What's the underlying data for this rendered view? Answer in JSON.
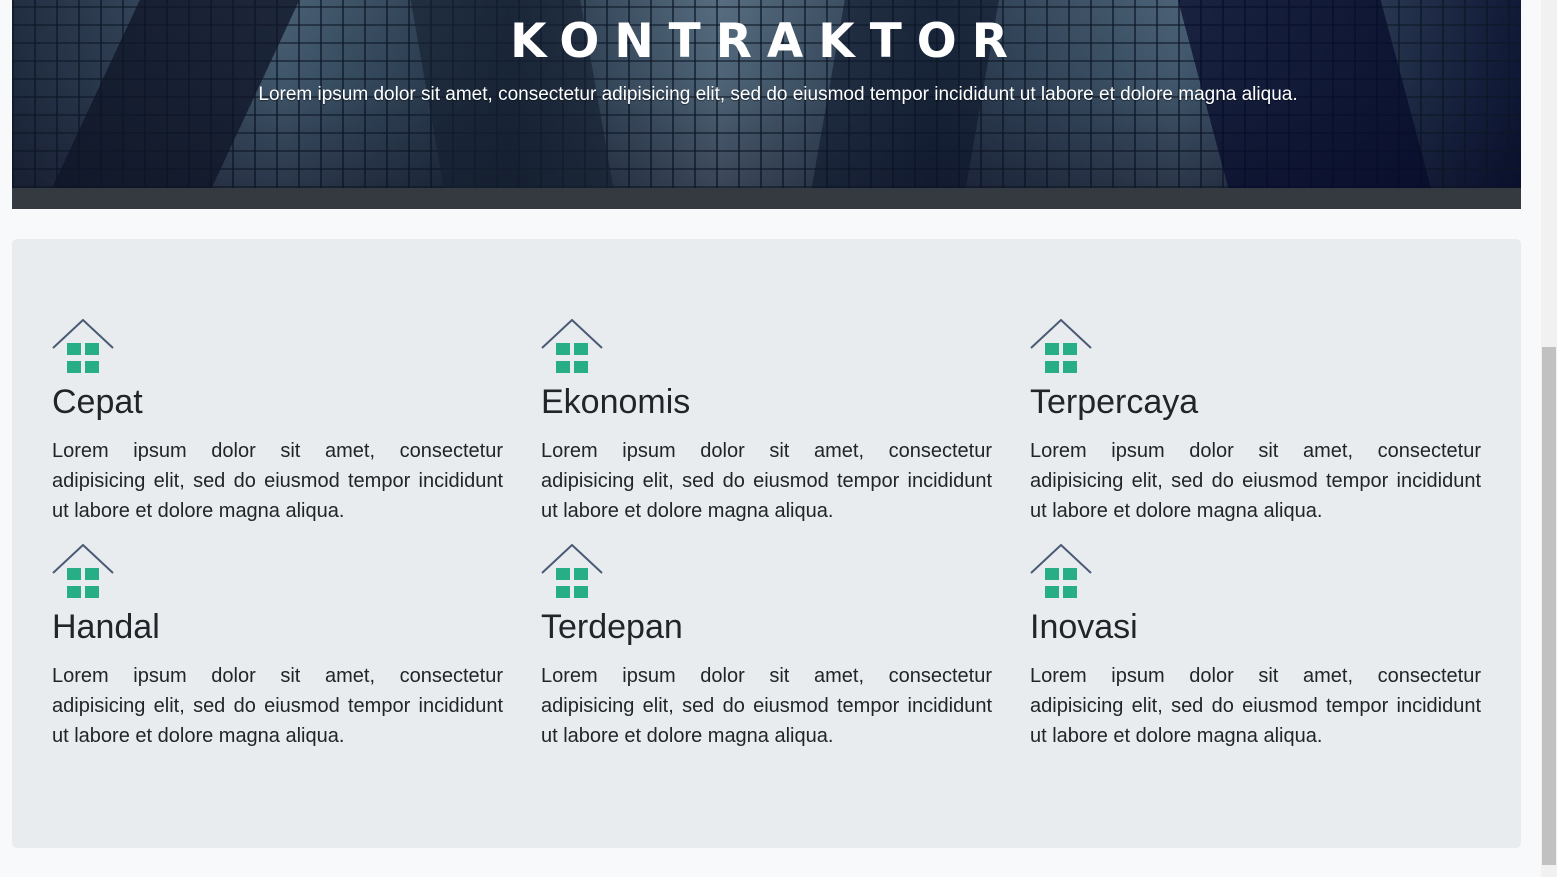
{
  "hero": {
    "title": "KONTRAKTOR",
    "subtitle": "Lorem ipsum dolor sit amet, consectetur adipisicing elit, sed do eiusmod tempor incididunt ut labore et dolore magna aliqua."
  },
  "features": {
    "items": [
      {
        "title": "Cepat",
        "text": "Lorem ipsum dolor sit amet, consectetur adipisicing elit, sed do eiusmod tempor incididunt ut labore et dolore magna aliqua.",
        "icon": "house-icon"
      },
      {
        "title": "Ekonomis",
        "text": "Lorem ipsum dolor sit amet, consectetur adipisicing elit, sed do eiusmod tempor incididunt ut labore et dolore magna aliqua.",
        "icon": "house-icon"
      },
      {
        "title": "Terpercaya",
        "text": "Lorem ipsum dolor sit amet, consectetur adipisicing elit, sed do eiusmod tempor incididunt ut labore et dolore magna aliqua.",
        "icon": "house-icon"
      },
      {
        "title": "Handal",
        "text": "Lorem ipsum dolor sit amet, consectetur adipisicing elit, sed do eiusmod tempor incididunt ut labore et dolore magna aliqua.",
        "icon": "house-icon"
      },
      {
        "title": "Terdepan",
        "text": "Lorem ipsum dolor sit amet, consectetur adipisicing elit, sed do eiusmod tempor incididunt ut labore et dolore magna aliqua.",
        "icon": "house-icon"
      },
      {
        "title": "Inovasi",
        "text": "Lorem ipsum dolor sit amet, consectetur adipisicing elit, sed do eiusmod tempor incididunt ut labore et dolore magna aliqua.",
        "icon": "house-icon"
      }
    ]
  },
  "colors": {
    "accent": "#27ae87",
    "roof": "#4b5b75",
    "hero_bar": "#343a40",
    "features_bg": "#e9ecef",
    "page_bg": "#f8f9fa"
  }
}
